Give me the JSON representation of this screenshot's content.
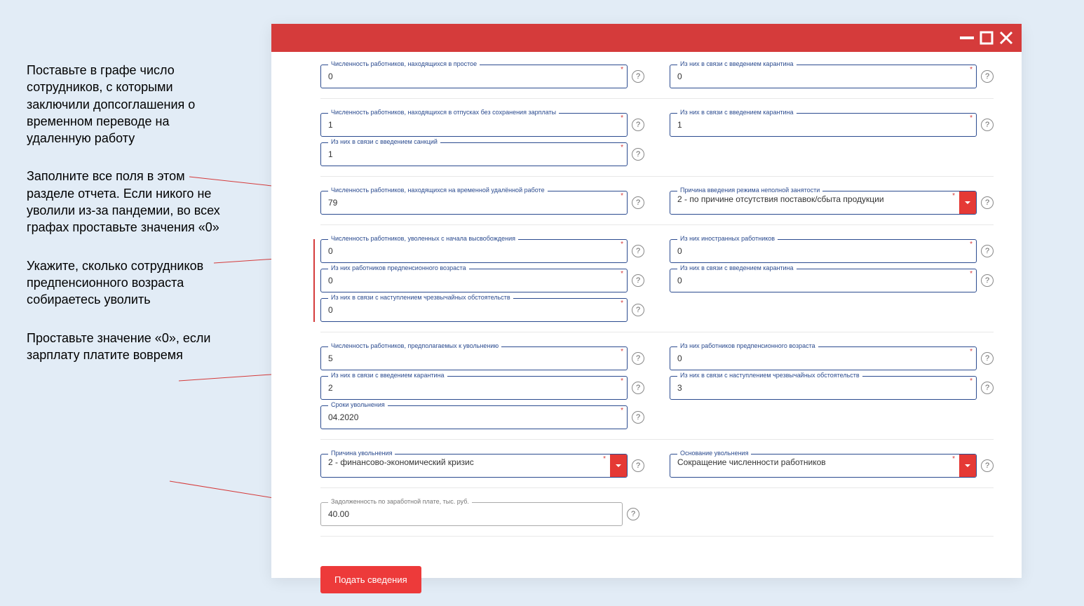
{
  "annotations": {
    "a1": "Поставьте в графе число сотрудников, с которыми заключили допсоглашения о временном переводе на удаленную работу",
    "a2": "Заполните все поля в этом разделе отчета. Если никого не уволили из-за пандемии, во всех графах проставьте значения «0»",
    "a3": "Укажите, сколько сотрудников предпенсионного возраста собираетесь уволить",
    "a4": "Проставьте значение «0», если зарплату платите вовремя"
  },
  "fields": {
    "idle_count": {
      "label": "Численность работников, находящихся в простое",
      "value": "0"
    },
    "idle_quarantine": {
      "label": "Из них в связи с введением карантина",
      "value": "0"
    },
    "unpaid_leave": {
      "label": "Численность работников, находящихся в отпусках без сохранения зарплаты",
      "value": "1"
    },
    "unpaid_leave_quarantine": {
      "label": "Из них в связи с введением карантина",
      "value": "1"
    },
    "sanctions": {
      "label": "Из них в связи с введением санкций",
      "value": "1"
    },
    "remote": {
      "label": "Численность работников, находящихся на временной удалённой работе",
      "value": "79"
    },
    "parttime_reason": {
      "label": "Причина введения режима неполной занятости",
      "value": "2 - по причине отсутствия поставок/сбыта продукции"
    },
    "dismissed": {
      "label": "Численность работников, уволенных с начала высвобождения",
      "value": "0"
    },
    "dismissed_foreign": {
      "label": "Из них иностранных работников",
      "value": "0"
    },
    "dismissed_prepension": {
      "label": "Из них работников предпенсионного возраста",
      "value": "0"
    },
    "dismissed_quarantine": {
      "label": "Из них в связи с введением карантина",
      "value": "0"
    },
    "dismissed_emergency": {
      "label": "Из них в связи с наступлением чрезвычайных обстоятельств",
      "value": "0"
    },
    "planned_dismiss": {
      "label": "Численность работников, предполагаемых к увольнению",
      "value": "5"
    },
    "planned_prepension": {
      "label": "Из них работников предпенсионного возраста",
      "value": "0"
    },
    "planned_quarantine": {
      "label": "Из них в связи с введением карантина",
      "value": "2"
    },
    "planned_emergency": {
      "label": "Из них в связи с наступлением чрезвычайных обстоятельств",
      "value": "3"
    },
    "dismiss_dates": {
      "label": "Сроки увольнения",
      "value": "04.2020"
    },
    "dismiss_reason": {
      "label": "Причина увольнения",
      "value": "2 - финансово-экономический кризис"
    },
    "dismiss_basis": {
      "label": "Основание увольнения",
      "value": "Сокращение численности работников"
    },
    "salary_debt": {
      "label": "Задолженность по заработной плате, тыс. руб.",
      "value": "40.00"
    }
  },
  "submit_label": "Подать сведения"
}
